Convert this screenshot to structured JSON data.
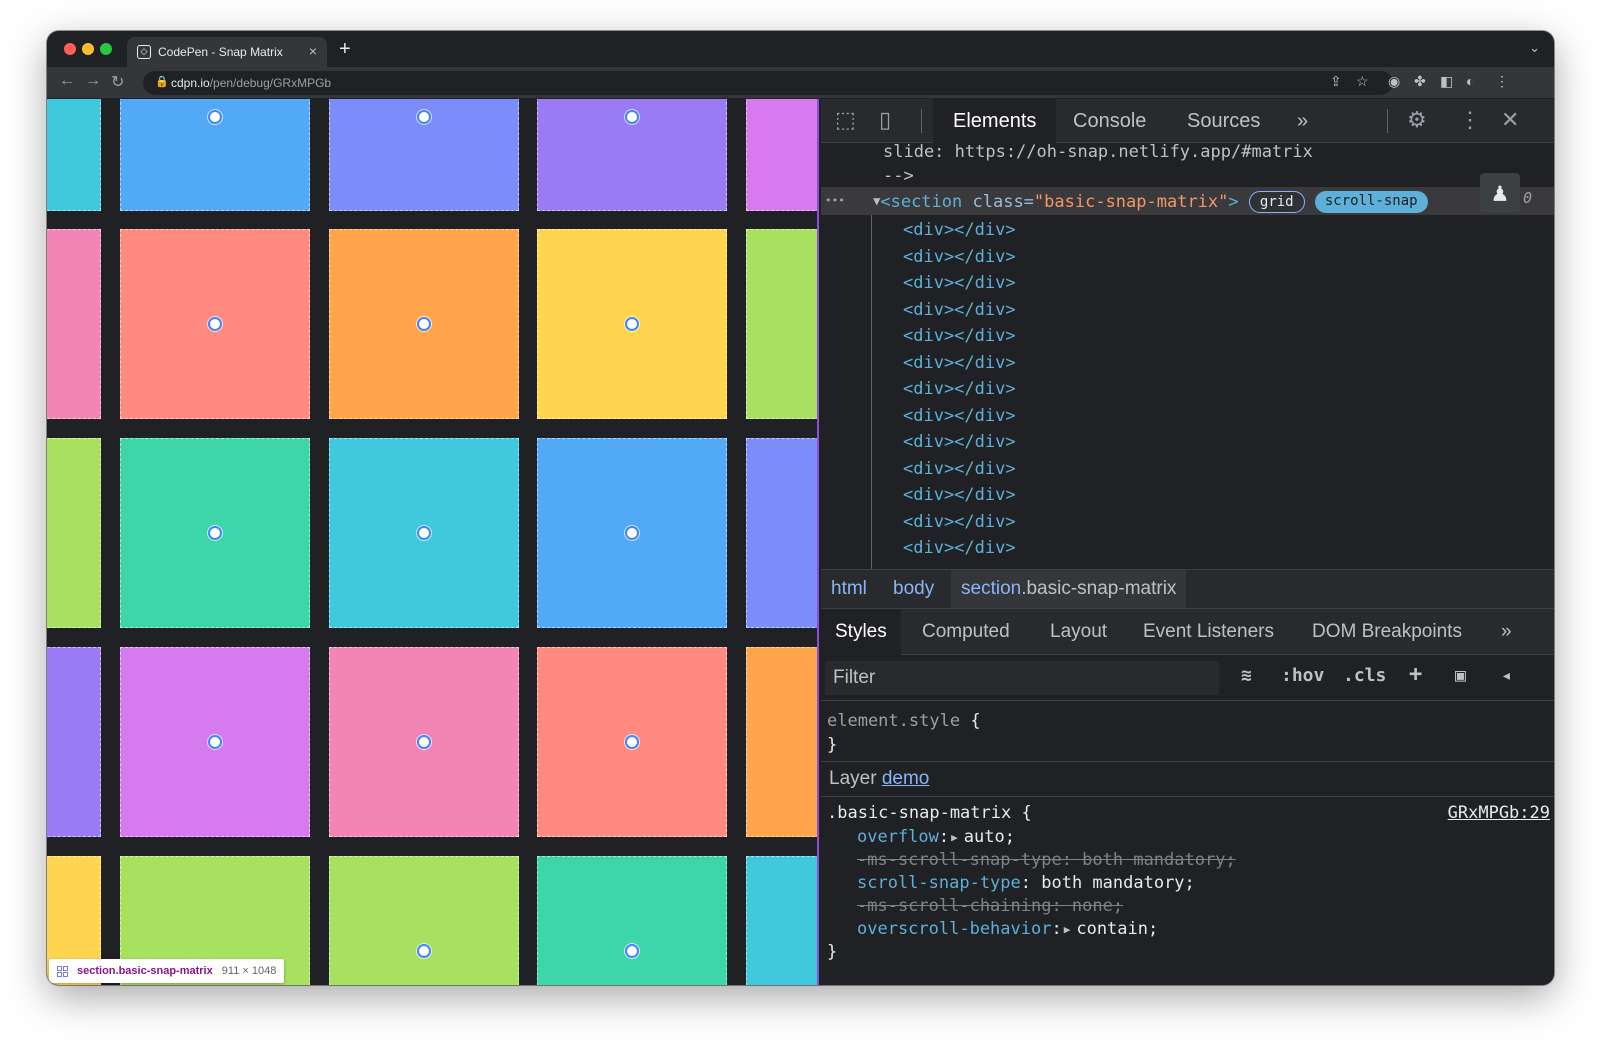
{
  "browser": {
    "tab_title": "CodePen - Snap Matrix",
    "tab_close": "×",
    "new_tab": "+",
    "url_host": "cdpn.io",
    "url_path": "/pen/debug/GRxMPGb"
  },
  "viewport": {
    "overlay_selector": "section.basic-snap-matrix",
    "overlay_size": "911 × 1048",
    "colors": [
      "#ff8a80",
      "#ffa64d",
      "#ffd54f",
      "#a8e05f",
      "#3dd6a8",
      "#40c8dc",
      "#52a9f5",
      "#7c8cf8",
      "#9b7af5",
      "#d67af0",
      "#f285b5"
    ]
  },
  "devtools": {
    "tabs": {
      "elements": "Elements",
      "console": "Console",
      "sources": "Sources",
      "more": "»"
    },
    "tree": {
      "comment_line": "slide: https://oh-snap.netlify.app/#matrix",
      "comment_end": "-->",
      "ellipsis": "•••",
      "open_tag": "<section",
      "attr_name": "class=",
      "attr_value": "\"basic-snap-matrix\"",
      "close_bracket": ">",
      "badge_grid": "grid",
      "badge_snap": "scroll-snap",
      "dollar0": "0",
      "child": "<div></div>",
      "child_count": 13
    },
    "breadcrumbs": {
      "html": "html",
      "body": "body",
      "section": "section",
      "section_class": ".basic-snap-matrix"
    },
    "styles_tabs": {
      "styles": "Styles",
      "computed": "Computed",
      "layout": "Layout",
      "event_listeners": "Event Listeners",
      "dom_breakpoints": "DOM Breakpoints",
      "more": "»"
    },
    "filter_placeholder": "Filter",
    "filter_buttons": {
      "hov": ":hov",
      "cls": ".cls",
      "add": "+"
    },
    "element_style": {
      "selector": "element.style",
      "open": "{",
      "close": "}"
    },
    "layer": {
      "label": "Layer",
      "link": "demo"
    },
    "rule": {
      "selector": ".basic-snap-matrix {",
      "source": "GRxMPGb:29",
      "overflow_prop": "overflow",
      "overflow_val": "auto;",
      "ms_snap": "-ms-scroll-snap-type: both mandatory;",
      "snap_prop": "scroll-snap-type",
      "snap_val": "both mandatory;",
      "ms_chain": "-ms-scroll-chaining: none;",
      "overscroll_prop": "overscroll-behavior",
      "overscroll_val": "contain;",
      "close": "}"
    }
  }
}
